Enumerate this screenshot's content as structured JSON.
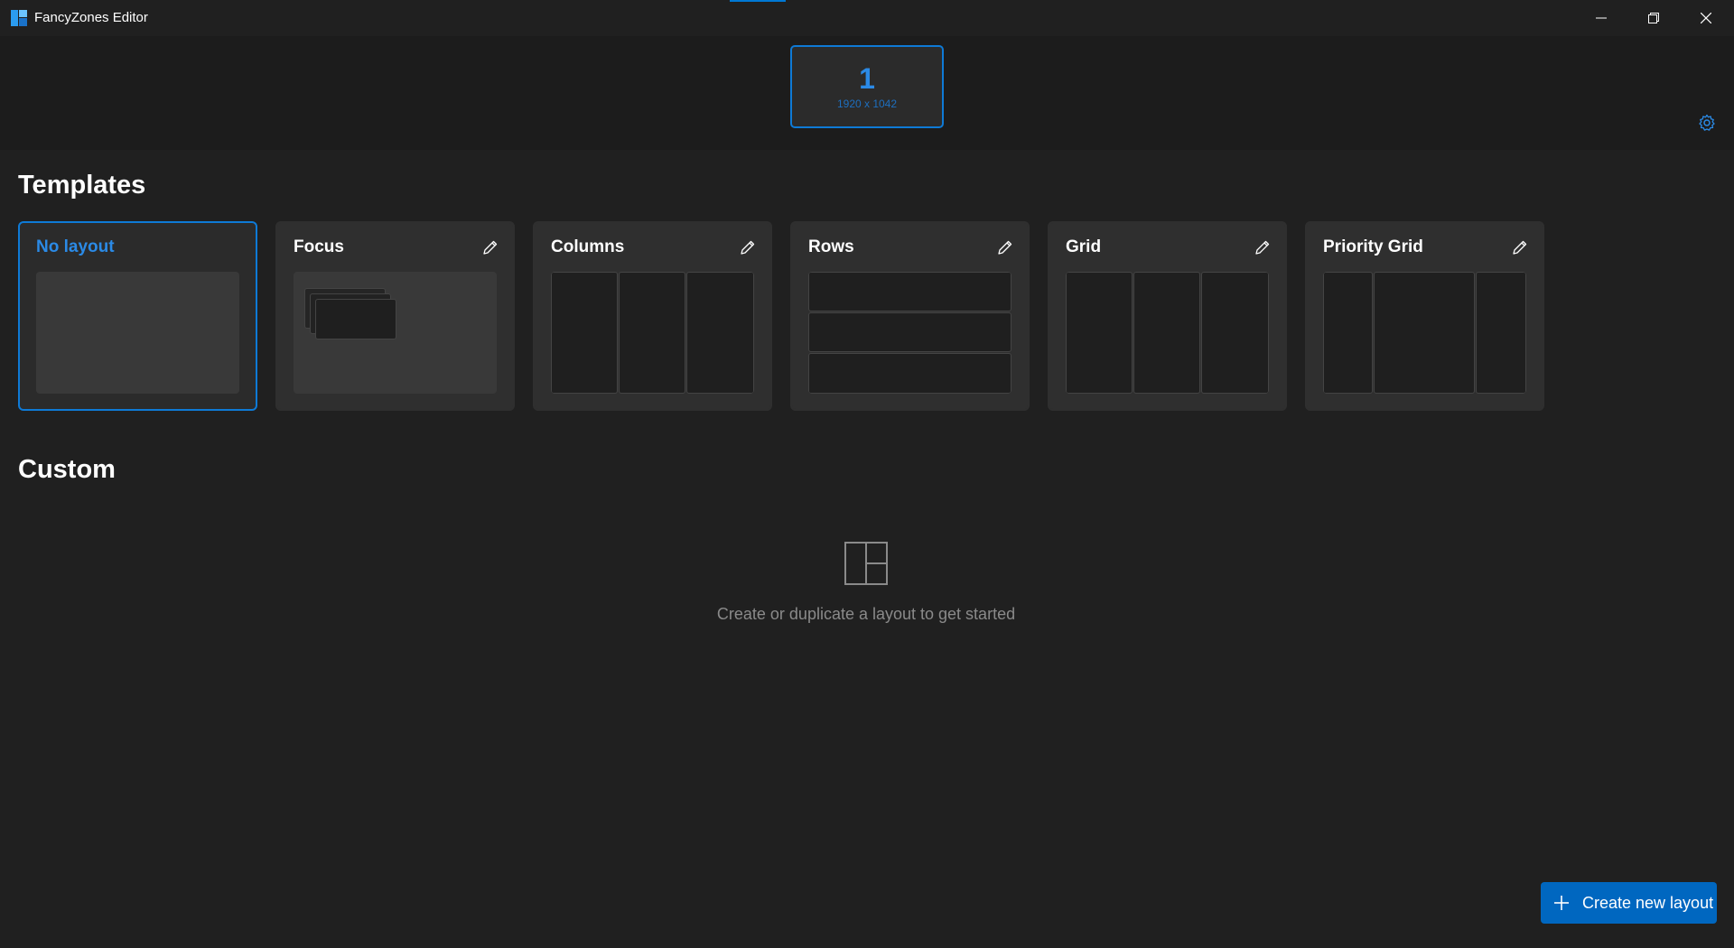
{
  "window": {
    "title": "FancyZones Editor",
    "minimize_label": "Minimize",
    "restore_label": "Restore",
    "close_label": "Close"
  },
  "monitor": {
    "number": "1",
    "resolution": "1920 x 1042"
  },
  "sections": {
    "templates_title": "Templates",
    "custom_title": "Custom"
  },
  "templates": [
    {
      "name": "No layout",
      "selected": true
    },
    {
      "name": "Focus",
      "selected": false
    },
    {
      "name": "Columns",
      "selected": false
    },
    {
      "name": "Rows",
      "selected": false
    },
    {
      "name": "Grid",
      "selected": false
    },
    {
      "name": "Priority Grid",
      "selected": false
    }
  ],
  "custom": {
    "empty_message": "Create or duplicate a layout to get started"
  },
  "actions": {
    "create_label": "Create new layout"
  },
  "colors": {
    "accent": "#0078d4",
    "background": "#202020",
    "card": "#2f2f2f"
  },
  "icons": {
    "app": "fancyzones-icon",
    "settings": "gear-icon",
    "edit": "pencil-icon",
    "empty": "layout-icon",
    "create": "plus-icon"
  }
}
